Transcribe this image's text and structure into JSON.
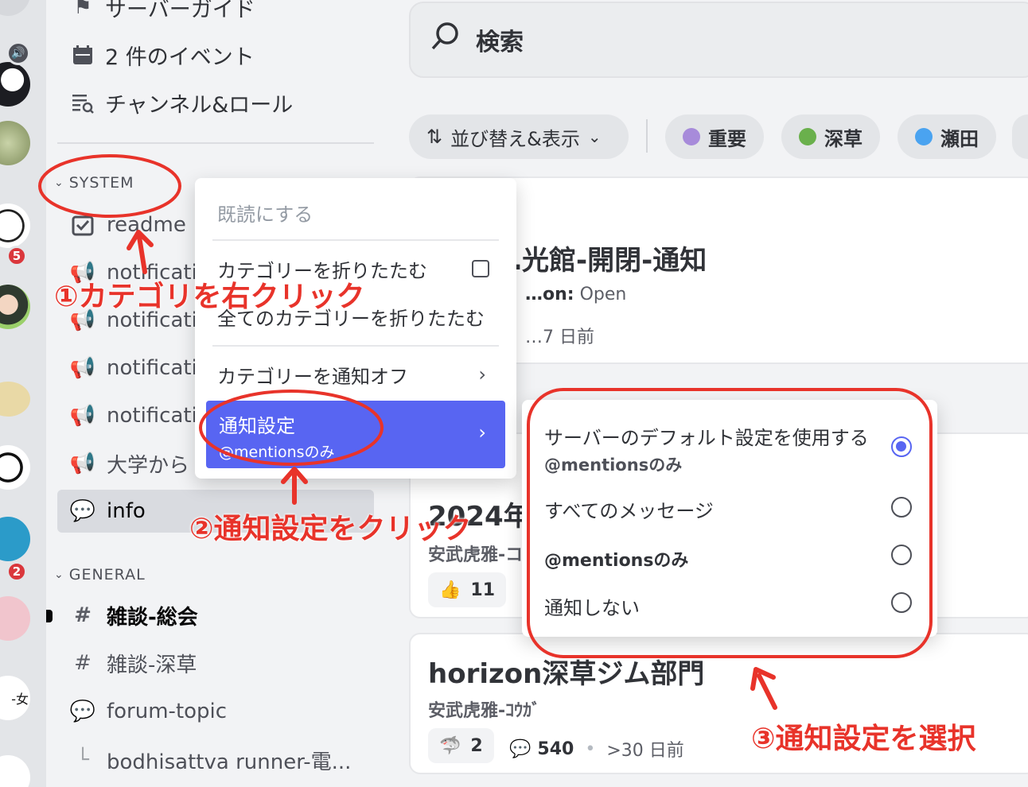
{
  "server_rail": {
    "badges": [
      "5",
      "2"
    ],
    "partial_label": "-女"
  },
  "sidebar": {
    "top_items": [
      {
        "label": "サーバーガイド",
        "icon": "signpost-icon"
      },
      {
        "label": "2 件のイベント",
        "icon": "calendar-icon"
      },
      {
        "label": "チャンネル&ロール",
        "icon": "channel-browse-icon"
      }
    ],
    "categories": [
      {
        "name": "SYSTEM",
        "channels": [
          {
            "label": "readme",
            "icon": "rules-icon"
          },
          {
            "label": "notificati",
            "icon": "announcement-icon"
          },
          {
            "label": "notificati",
            "icon": "announcement-icon"
          },
          {
            "label": "notificati",
            "icon": "announcement-icon"
          },
          {
            "label": "notificati",
            "icon": "announcement-icon"
          },
          {
            "label": "大学から",
            "icon": "announcement-icon"
          },
          {
            "label": "info",
            "icon": "forum-icon"
          }
        ]
      },
      {
        "name": "GENERAL",
        "channels": [
          {
            "label": "雑談-総会",
            "icon": "hash-icon"
          },
          {
            "label": "雑談-深草",
            "icon": "hash-thread-icon"
          },
          {
            "label": "forum-topic",
            "icon": "forum-icon"
          },
          {
            "label": "bodhisattva runner-電...",
            "icon": "thread-branch-icon"
          }
        ]
      }
    ]
  },
  "main": {
    "search_placeholder": "検索",
    "sort_label": "並び替え&表示",
    "tags": [
      {
        "label": "重要",
        "color": "#a78bda"
      },
      {
        "label": "深草",
        "color": "#6ab04c"
      },
      {
        "label": "瀬田",
        "color": "#4aa3f0"
      }
    ],
    "posts": [
      {
        "title": "…光館-開閉-通知",
        "meta_label": "…on:",
        "meta_value": "Open",
        "time": "…7 日前"
      },
      {
        "title": "2024年…",
        "author": "安武虎雅-コ…",
        "reaction_count": "11"
      },
      {
        "title": "horizon深草ジム部門",
        "author": "安武虎雅-ｺｳｶﾞ",
        "reaction_count": "2",
        "comment_count": "540",
        "time": ">30 日前"
      }
    ]
  },
  "context_menu": {
    "mark_read": "既読にする",
    "collapse_category": "カテゴリーを折りたたむ",
    "collapse_all": "全てのカテゴリーを折りたたむ",
    "mute_category": "カテゴリーを通知オフ",
    "notify_settings": "通知設定",
    "notify_settings_current": "@mentionsのみ"
  },
  "submenu": {
    "options": [
      {
        "label": "サーバーのデフォルト設定を使用する",
        "sub": "@mentionsのみ",
        "selected": true
      },
      {
        "label": "すべてのメッセージ",
        "selected": false
      },
      {
        "label": "@mentionsのみ",
        "selected": false
      },
      {
        "label": "通知しない",
        "selected": false
      }
    ]
  },
  "annotations": {
    "step1": "①カテゴリを右クリック",
    "step2": "②通知設定をクリック",
    "step3": "③通知設定を選択",
    "color": "#e8332a"
  }
}
